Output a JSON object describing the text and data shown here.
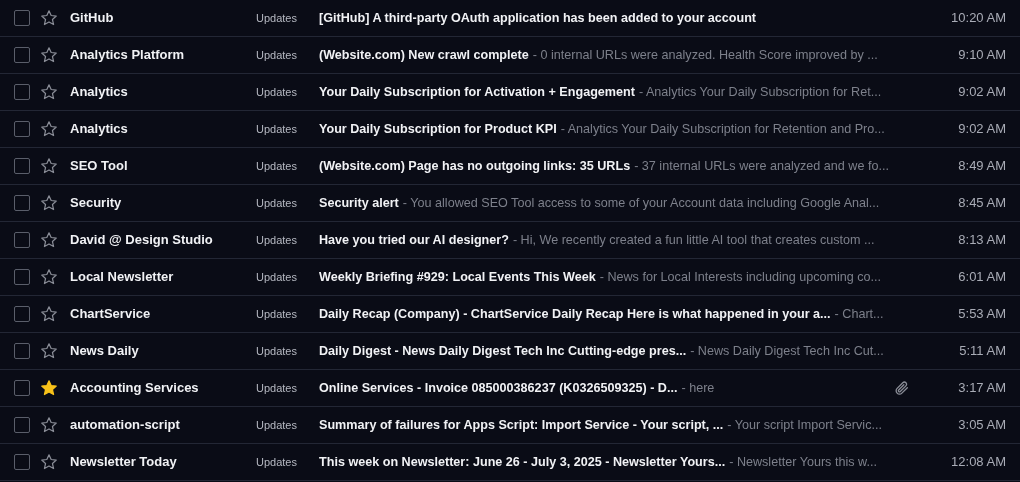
{
  "emails": [
    {
      "sender": "GitHub",
      "label": "Updates",
      "subject": "[GitHub] A third-party OAuth application has been added to your account",
      "time": "10:20 AM",
      "checked": false,
      "starred": false,
      "attachment": false
    },
    {
      "sender": "Analytics Platform",
      "label": "Updates",
      "subject": "(Website.com) New crawl complete",
      "snippet": "- 0 internal URLs were analyzed. Health Score improved by ...",
      "time": "9:10 AM",
      "checked": false,
      "starred": false,
      "attachment": false
    },
    {
      "sender": "Analytics",
      "label": "Updates",
      "subject": "Your Daily Subscription for Activation + Engagement",
      "snippet": "- Analytics Your Daily Subscription for Ret...",
      "time": "9:02 AM",
      "checked": false,
      "starred": false,
      "attachment": false
    },
    {
      "sender": "Analytics",
      "label": "Updates",
      "subject": "Your Daily Subscription for Product KPI",
      "snippet": "- Analytics Your Daily Subscription for Retention and Pro...",
      "time": "9:02 AM",
      "checked": false,
      "starred": false,
      "attachment": false
    },
    {
      "sender": "SEO Tool",
      "label": "Updates",
      "subject": "(Website.com) Page has no outgoing links: 35 URLs",
      "snippet": "- 37 internal URLs were analyzed and we fo...",
      "time": "8:49 AM",
      "checked": false,
      "starred": false,
      "attachment": false
    },
    {
      "sender": "Security",
      "label": "Updates",
      "subject": "Security alert",
      "snippet": "- You allowed SEO Tool access to some of your Account data including Google Anal...",
      "time": "8:45 AM",
      "checked": false,
      "starred": false,
      "attachment": false
    },
    {
      "sender": "David @ Design Studio",
      "label": "Updates",
      "subject": "Have you tried our AI designer?",
      "snippet": "- Hi, We recently created a fun little AI tool that creates custom ...",
      "time": "8:13 AM",
      "checked": false,
      "starred": false,
      "attachment": false
    },
    {
      "sender": "Local Newsletter",
      "label": "Updates",
      "subject": "Weekly Briefing #929: Local Events This Week",
      "snippet": "- News for Local Interests including upcoming co...",
      "time": "6:01 AM",
      "checked": false,
      "starred": false,
      "attachment": false
    },
    {
      "sender": "ChartService",
      "label": "Updates",
      "subject": "Daily Recap (Company) - ChartService Daily Recap Here is what happened in your a...",
      "snippet": "- Chart...",
      "time": "5:53 AM",
      "checked": false,
      "starred": false,
      "attachment": false
    },
    {
      "sender": "News Daily",
      "label": "Updates",
      "subject": "Daily Digest - News Daily Digest Tech Inc Cutting-edge pres...",
      "snippet": "- News Daily Digest Tech Inc Cut...",
      "time": "5:11 AM",
      "checked": false,
      "starred": false,
      "attachment": false
    },
    {
      "sender": "Accounting Services",
      "label": "Updates",
      "subject": "Online Services - Invoice 085000386237 (K0326509325) - D...",
      "snippet": "- here",
      "time": "3:17 AM",
      "checked": false,
      "starred": true,
      "attachment": true
    },
    {
      "sender": "automation-script",
      "label": "Updates",
      "subject": "Summary of failures for Apps Script: Import Service - Your script, ...",
      "snippet": "- Your script Import Servic...",
      "time": "3:05 AM",
      "checked": false,
      "starred": false,
      "attachment": false
    },
    {
      "sender": "Newsletter Today",
      "label": "Updates",
      "subject": "This week on Newsletter: June 26 - July 3, 2025 - Newsletter Yours...",
      "snippet": "- Newsletter Yours this w...",
      "time": "12:08 AM",
      "checked": false,
      "starred": false,
      "attachment": false
    }
  ]
}
